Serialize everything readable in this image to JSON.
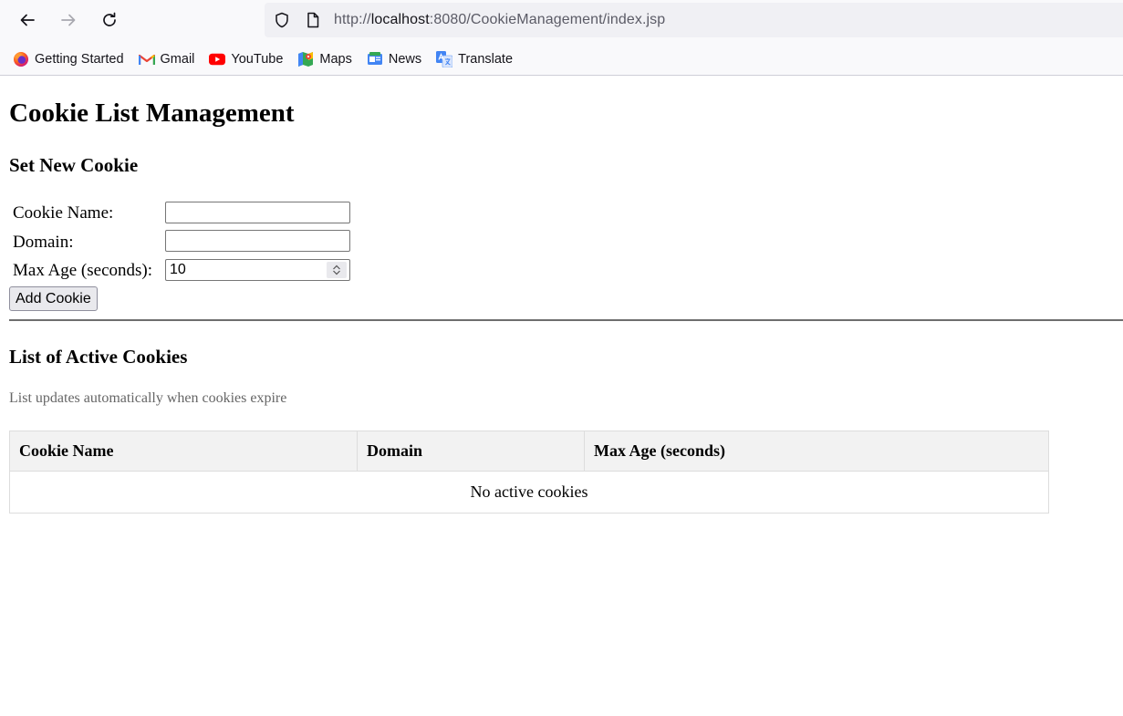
{
  "browser": {
    "url_scheme": "http://",
    "url_host": "localhost",
    "url_path": ":8080/CookieManagement/index.jsp",
    "bookmarks": [
      {
        "label": "Getting Started",
        "icon": "firefox-icon"
      },
      {
        "label": "Gmail",
        "icon": "gmail-icon"
      },
      {
        "label": "YouTube",
        "icon": "youtube-icon"
      },
      {
        "label": "Maps",
        "icon": "maps-icon"
      },
      {
        "label": "News",
        "icon": "news-icon"
      },
      {
        "label": "Translate",
        "icon": "translate-icon"
      }
    ]
  },
  "page": {
    "title": "Cookie List Management",
    "set_section_title": "Set New Cookie",
    "form": {
      "name_label": "Cookie Name:",
      "name_value": "",
      "domain_label": "Domain:",
      "domain_value": "",
      "maxage_label": "Max Age (seconds):",
      "maxage_value": "10",
      "submit_label": "Add Cookie"
    },
    "list_section_title": "List of Active Cookies",
    "list_note": "List updates automatically when cookies expire",
    "table": {
      "headers": [
        "Cookie Name",
        "Domain",
        "Max Age (seconds)"
      ],
      "empty_message": "No active cookies"
    }
  },
  "colors": {
    "chrome_bg": "#f9f9fb",
    "urlbar_bg": "#f0f0f4",
    "table_header_bg": "#f2f2f2",
    "note_text": "#666666"
  }
}
